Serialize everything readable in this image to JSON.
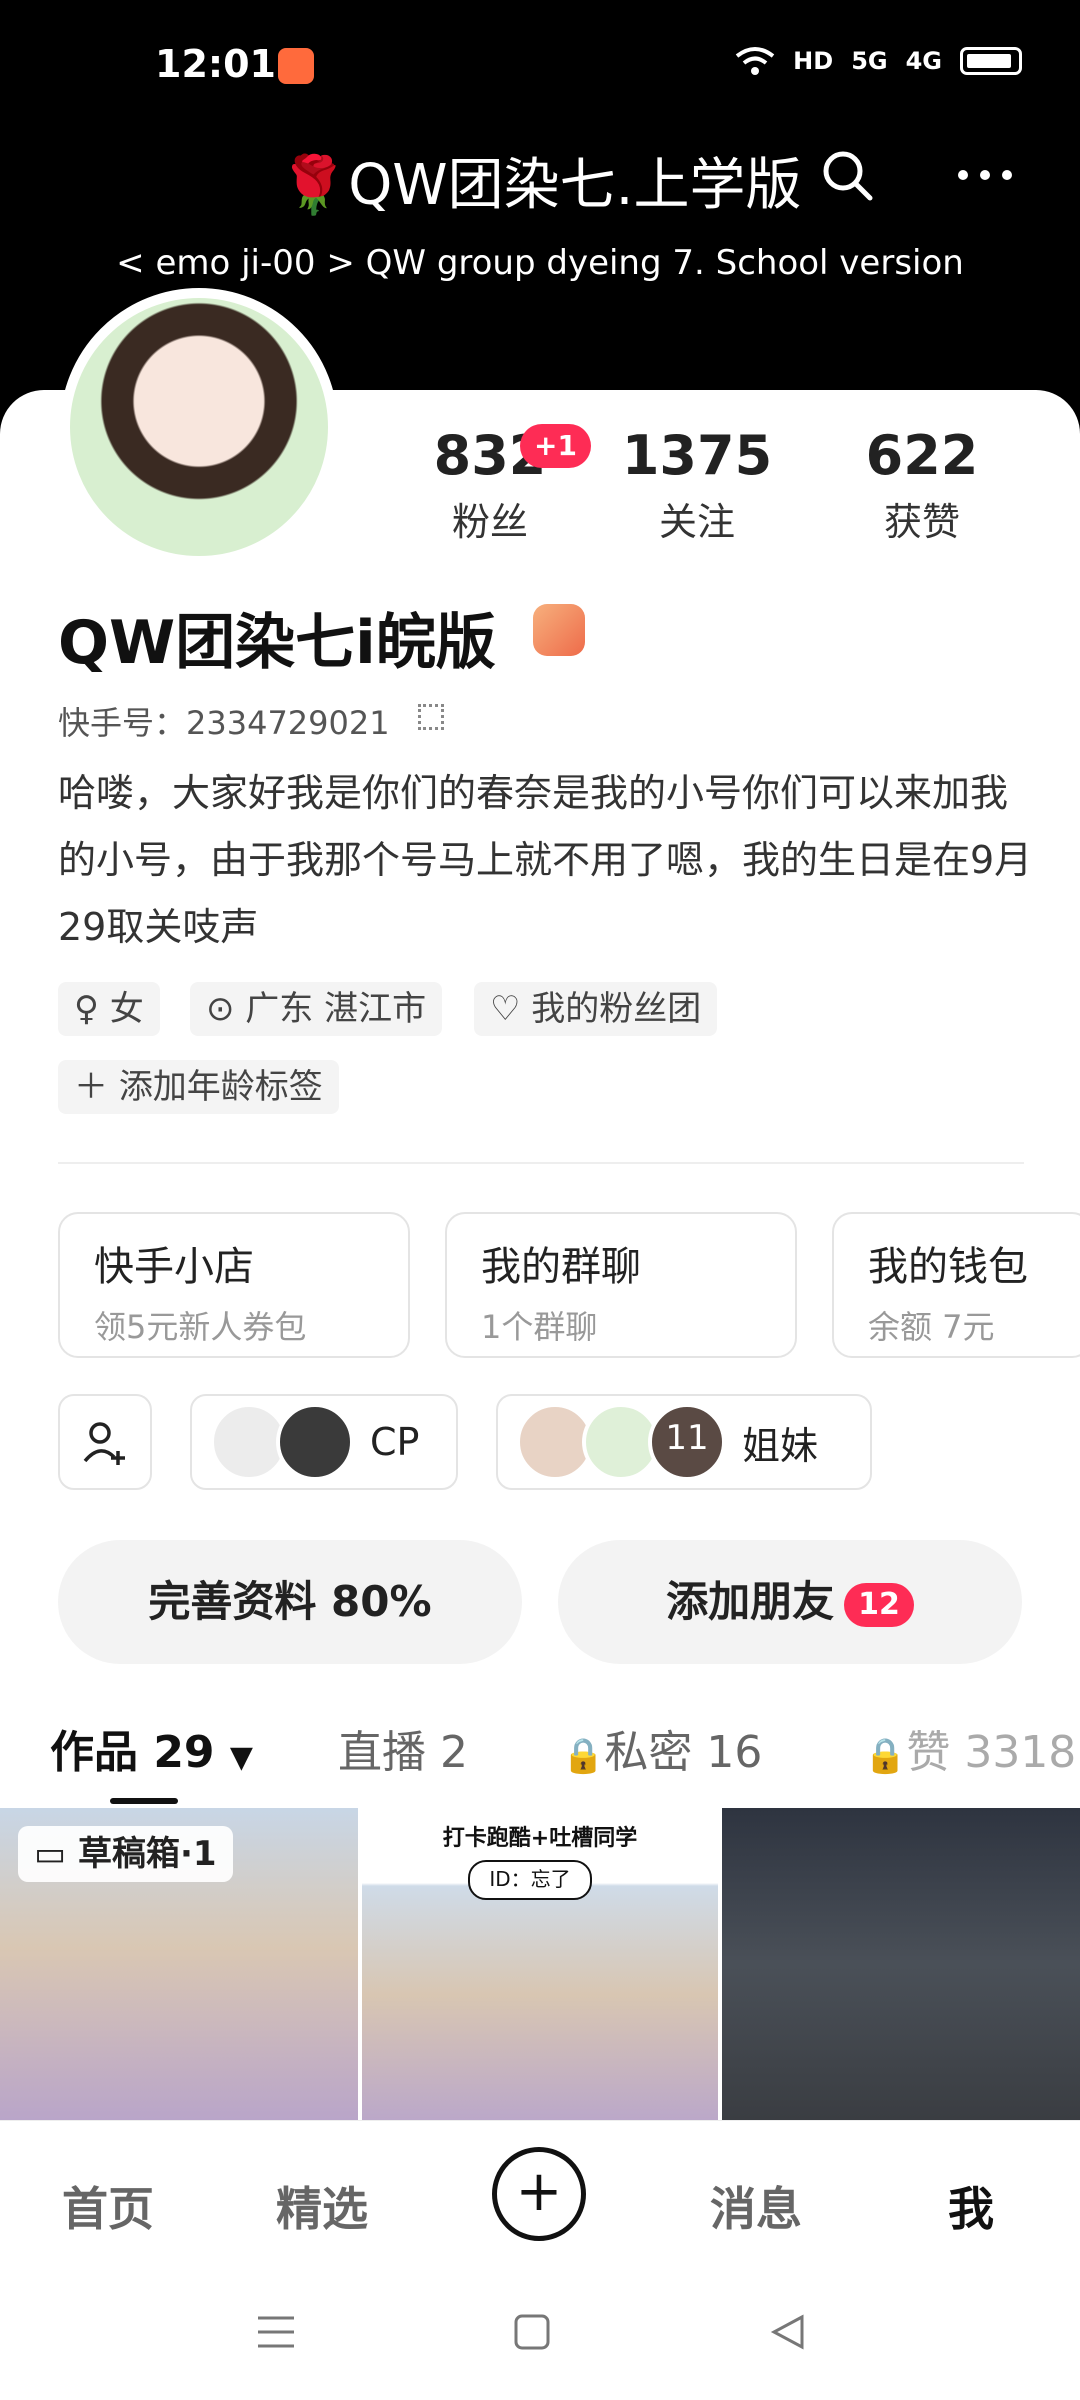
{
  "status": {
    "time": "12:01",
    "network": [
      "HD",
      "5G",
      "4G"
    ]
  },
  "header": {
    "title": "🌹QW团染七.上学版",
    "subtitle": "< emo ji-00 > QW group dyeing 7. School version"
  },
  "stats": [
    {
      "num": "832",
      "label": "粉丝"
    },
    {
      "num": "1375",
      "label": "关注"
    },
    {
      "num": "622",
      "label": "获赞"
    }
  ],
  "fans_increase": "+1",
  "profile": {
    "name": "QW团染七i皖版",
    "kuaishou_id": "快手号：2334729021",
    "bio": "哈喽，大家好我是你们的春奈是我的小号你们可以来加我的小号，由于我那个号马上就不用了嗯，我的生日是在9月29取关吱声"
  },
  "tags": [
    "女",
    "广东 湛江市",
    "我的粉丝团"
  ],
  "add_age_tag": "添加年龄标签",
  "services": [
    {
      "title": "快手小店",
      "sub": "领5元新人券包"
    },
    {
      "title": "我的群聊",
      "sub": "1个群聊"
    },
    {
      "title": "我的钱包",
      "sub": "余额 7元"
    }
  ],
  "relations": {
    "cp": "CP",
    "sisters": "姐妹",
    "count": "11"
  },
  "actions": {
    "complete_profile": "完善资料 80%",
    "add_friends": "添加朋友",
    "add_friends_count": "12"
  },
  "tabs": [
    {
      "label": "作品 29"
    },
    {
      "label": "直播 2"
    },
    {
      "label": "私密 16"
    },
    {
      "label": "赞 3318"
    }
  ],
  "thumbs": {
    "draft": "草稿箱·1",
    "caption": "打卡跑酷+吐槽同学",
    "bubble": "ID：忘了"
  },
  "nav": [
    "首页",
    "精选",
    "消息",
    "我"
  ],
  "colors": {
    "accent": "#fe2c55",
    "header_bg": "#000000"
  }
}
